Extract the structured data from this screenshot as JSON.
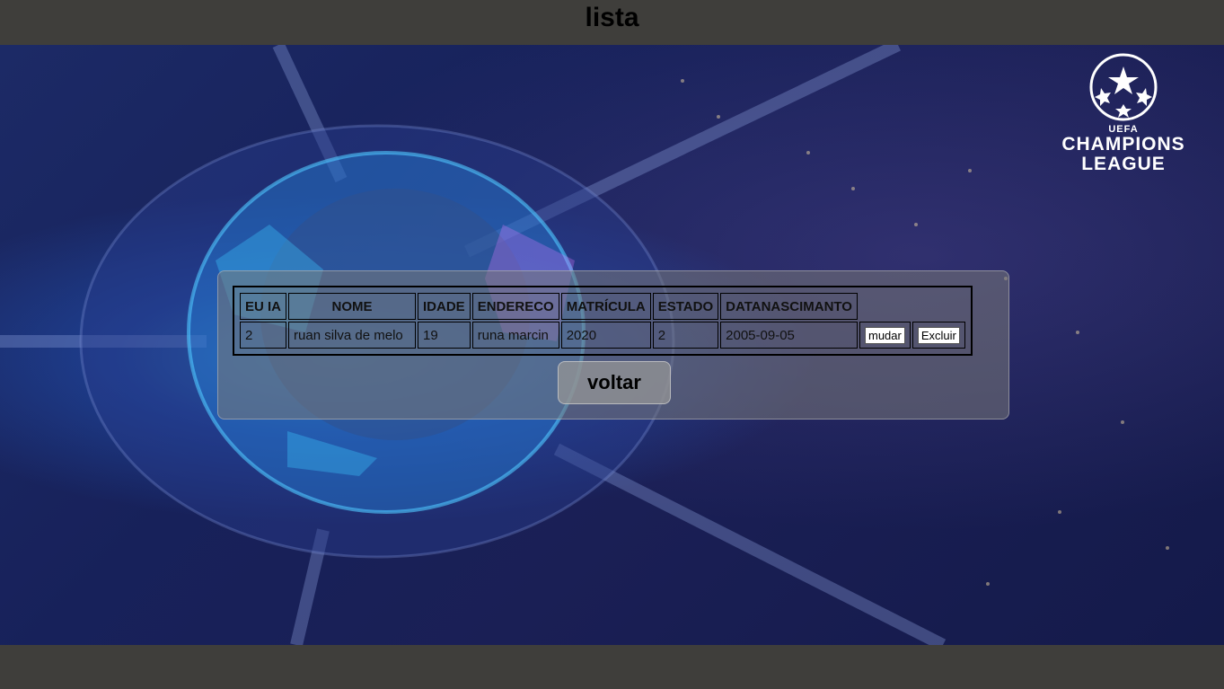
{
  "header": {
    "title": "lista"
  },
  "logo": {
    "line1": "UEFA",
    "line2": "CHAMPIONS",
    "line3": "LEAGUE"
  },
  "table": {
    "headers": [
      "EU IA",
      "NOME",
      "IDADE",
      "ENDERECO",
      "MATRÍCULA",
      "ESTADO",
      "DATANASCIMANTO"
    ],
    "rows": [
      {
        "cells": [
          "2",
          "ruan silva de melo",
          "19",
          "runa marcin",
          "2020",
          "2",
          "2005-09-05"
        ]
      }
    ],
    "edit_label": "mudar",
    "delete_label": "Excluir"
  },
  "back_button": {
    "label": "voltar"
  },
  "colors": {
    "bar": "#3f3e3b",
    "panel": "#7a7a7a"
  }
}
